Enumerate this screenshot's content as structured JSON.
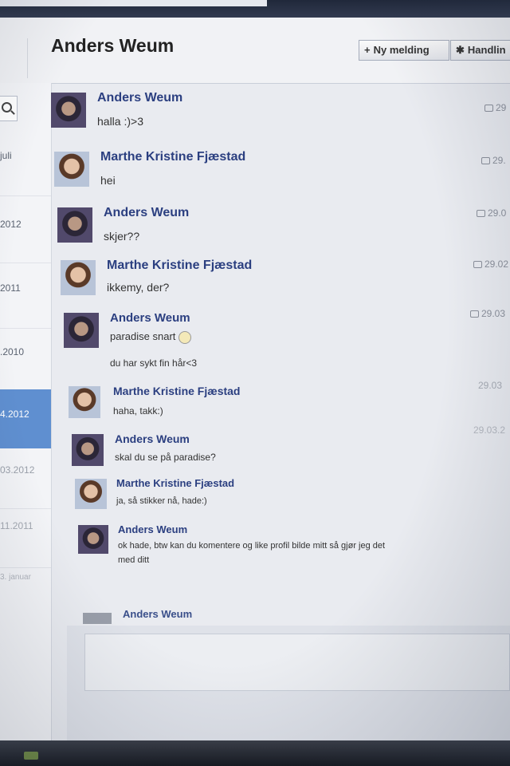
{
  "header": {
    "title": "Anders Weum",
    "new_message_label": "Ny melding",
    "actions_label": "Handlin"
  },
  "sidebar": {
    "items": [
      {
        "label": "juli"
      },
      {
        "label": "2012"
      },
      {
        "label": "2011"
      },
      {
        "label": ".2010"
      },
      {
        "label": "4.2012"
      },
      {
        "label": "03.2012"
      },
      {
        "label": "11.2011"
      },
      {
        "label": "3. januar"
      }
    ]
  },
  "messages": [
    {
      "sender": "Anders Weum",
      "lines": [
        "halla :)>3"
      ],
      "time": "29"
    },
    {
      "sender": "Marthe Kristine Fjæstad",
      "lines": [
        "hei"
      ],
      "time": "29."
    },
    {
      "sender": "Anders Weum",
      "lines": [
        "skjer??"
      ],
      "time": "29.0"
    },
    {
      "sender": "Marthe Kristine Fjæstad",
      "lines": [
        "ikkemy, der?"
      ],
      "time": "29.02"
    },
    {
      "sender": "Anders Weum",
      "lines": [
        "paradise snart",
        "du har sykt fin hår<3"
      ],
      "time": "29.03"
    },
    {
      "sender": "Marthe Kristine Fjæstad",
      "lines": [
        "haha, takk:)"
      ],
      "time": "29.03"
    },
    {
      "sender": "Anders Weum",
      "lines": [
        "skal du se på paradise?"
      ],
      "time": "29.03.2"
    },
    {
      "sender": "Marthe Kristine Fjæstad",
      "lines": [
        "ja, så stikker nå, hade:)"
      ],
      "time": ""
    },
    {
      "sender": "Anders Weum",
      "lines": [
        "ok hade, btw kan du komentere og like profil bilde mitt så gjør jeg det",
        "med ditt"
      ],
      "time": ""
    }
  ],
  "composer": {
    "name": "Anders Weum",
    "placeholder": ""
  }
}
